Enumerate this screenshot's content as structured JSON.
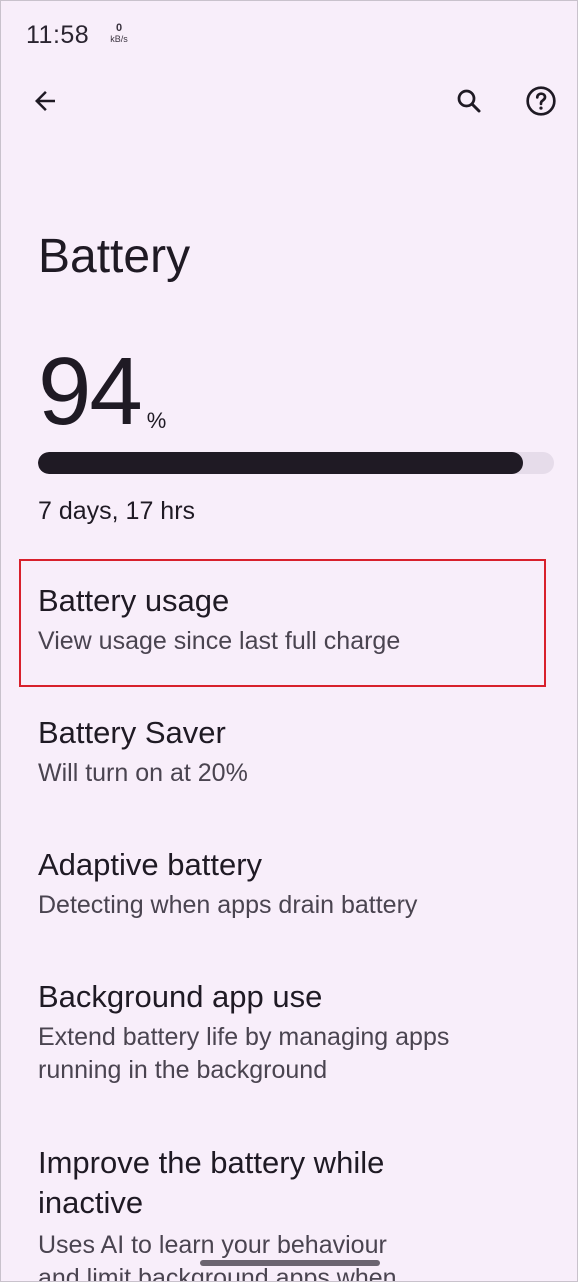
{
  "status_bar": {
    "time": "11:58",
    "net_speed_value": "0",
    "net_speed_unit": "kB/s"
  },
  "app_bar": {
    "back_icon": "arrow-left-icon",
    "search_icon": "search-icon",
    "help_icon": "help-circle-icon"
  },
  "page": {
    "title": "Battery"
  },
  "battery": {
    "level_value": "94",
    "level_unit": "%",
    "level_fraction": 0.94,
    "time_remaining": "7 days, 17 hrs"
  },
  "items": [
    {
      "title": "Battery usage",
      "subtitle_lines": [
        "View usage since last full charge"
      ],
      "highlighted": true
    },
    {
      "title": "Battery Saver",
      "subtitle_lines": [
        "Will turn on at 20%"
      ]
    },
    {
      "title": "Adaptive battery",
      "subtitle_lines": [
        "Detecting when apps drain battery"
      ]
    },
    {
      "title": "Background app use",
      "subtitle_lines": [
        "Extend battery life by managing apps",
        "running in the background"
      ]
    },
    {
      "title_lines": [
        "Improve the battery while",
        "inactive"
      ],
      "subtitle_lines": [
        "Uses AI to learn your behaviour",
        "and limit background apps when"
      ]
    }
  ],
  "colors": {
    "background": "#f8eefa",
    "on_surface": "#1f1a24",
    "highlight_border": "#d8202c"
  }
}
